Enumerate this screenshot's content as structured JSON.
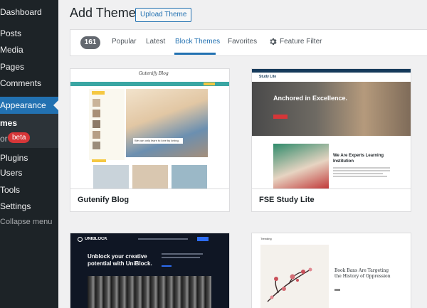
{
  "sidebar": {
    "items": [
      {
        "label": "Dashboard"
      },
      {
        "label": "Posts"
      },
      {
        "label": "Media"
      },
      {
        "label": "Pages"
      },
      {
        "label": "Comments"
      },
      {
        "label": "Appearance"
      },
      {
        "label": "Plugins"
      },
      {
        "label": "Users"
      },
      {
        "label": "Tools"
      },
      {
        "label": "Settings"
      }
    ],
    "submenu": {
      "themes": "mes",
      "editor": "or",
      "beta": "beta"
    },
    "collapse": "Collapse menu"
  },
  "header": {
    "title": "Add Themes",
    "upload_label": "Upload Theme"
  },
  "filters": {
    "count": "161",
    "tabs": [
      "Popular",
      "Latest",
      "Block Themes",
      "Favorites"
    ],
    "current": "Block Themes",
    "feature_filter": "Feature Filter"
  },
  "themes": [
    {
      "name": "Gutenify Blog",
      "preview": {
        "logo": "Gutenify Blog",
        "caption": "We can only learn to love by loving."
      }
    },
    {
      "name": "FSE Study Lite",
      "preview": {
        "logo": "Study Lite",
        "hero": "Anchored in Excellence.",
        "subhead": "We Are Experts Learning Institution"
      }
    },
    {
      "name": "",
      "preview": {
        "logo": "UNIBLOCK",
        "hero": "Unblock your creative potential with UniBlock."
      }
    },
    {
      "name": "",
      "preview": {
        "logo": "Trending",
        "headline": "Book Bans Are Targeting the History of Oppression"
      }
    }
  ],
  "colors": {
    "accent": "#2271b1",
    "sidebar": "#1d2327",
    "badge_red": "#d63638",
    "teal": "#3aa6a3"
  }
}
